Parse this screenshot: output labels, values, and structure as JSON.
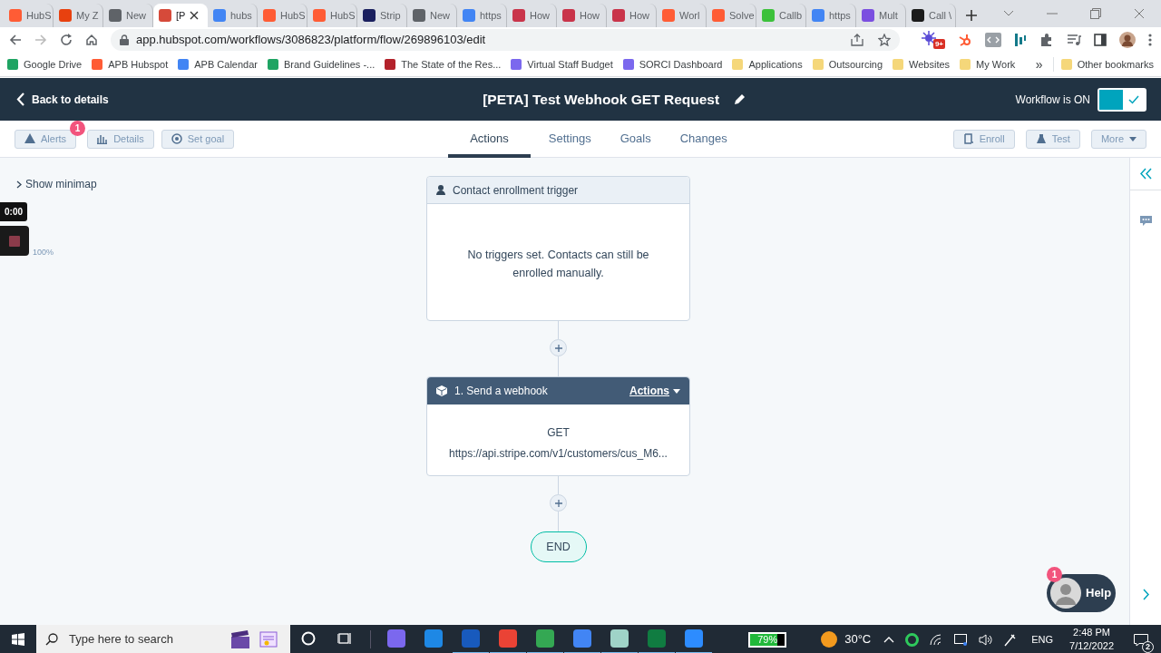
{
  "browser": {
    "tabs": [
      {
        "title": "HubS",
        "color": "#ff5c35",
        "selected": false
      },
      {
        "title": "My Z",
        "color": "#e8410f",
        "selected": false
      },
      {
        "title": "New",
        "color": "#5f6368",
        "selected": false
      },
      {
        "title": "[P",
        "color": "#d64a3a",
        "selected": true
      },
      {
        "title": "hubs",
        "color": "#4285f4",
        "selected": false
      },
      {
        "title": "HubS",
        "color": "#ff5c35",
        "selected": false
      },
      {
        "title": "HubS",
        "color": "#ff5c35",
        "selected": false
      },
      {
        "title": "Strip",
        "color": "#1a1f5e",
        "selected": false
      },
      {
        "title": "New",
        "color": "#5f6368",
        "selected": false
      },
      {
        "title": "https",
        "color": "#4285f4",
        "selected": false
      },
      {
        "title": "How",
        "color": "#c9344a",
        "selected": false
      },
      {
        "title": "How",
        "color": "#c9344a",
        "selected": false
      },
      {
        "title": "How",
        "color": "#c9344a",
        "selected": false
      },
      {
        "title": "Worl",
        "color": "#ff5c35",
        "selected": false
      },
      {
        "title": "Solve",
        "color": "#ff5c35",
        "selected": false
      },
      {
        "title": "Callb",
        "color": "#3cc13b",
        "selected": false
      },
      {
        "title": "https",
        "color": "#4285f4",
        "selected": false
      },
      {
        "title": "Mult",
        "color": "#7b4fe0",
        "selected": false
      },
      {
        "title": "Call \\",
        "color": "#1b1b1b",
        "selected": false
      }
    ],
    "forward_disabled": true,
    "url": "app.hubspot.com/workflows/3086823/platform/flow/269896103/edit",
    "extension_badge": "9+",
    "bookmarks": [
      {
        "label": "Google Drive",
        "color": "#1fa463"
      },
      {
        "label": "APB Hubspot",
        "color": "#ff5c35"
      },
      {
        "label": "APB Calendar",
        "color": "#4285f4"
      },
      {
        "label": "Brand Guidelines -...",
        "color": "#1fa463"
      },
      {
        "label": "The State of the Res...",
        "color": "#b3222b"
      },
      {
        "label": "Virtual Staff Budget",
        "color": "#7b68ee"
      },
      {
        "label": "SORCI Dashboard",
        "color": "#7b68ee"
      },
      {
        "label": "Applications",
        "color": "#f5d77a"
      },
      {
        "label": "Outsourcing",
        "color": "#f5d77a"
      },
      {
        "label": "Websites",
        "color": "#f5d77a"
      },
      {
        "label": "My Work",
        "color": "#f5d77a"
      }
    ],
    "more_bookmarks": "»",
    "other_bookmarks": "Other bookmarks"
  },
  "header": {
    "back": "Back to details",
    "title": "[PETA] Test Webhook GET Request",
    "status": "Workflow is ON",
    "enabled": true
  },
  "left_buttons": [
    {
      "kind": "alert",
      "label": "Alerts",
      "badge": "1"
    },
    {
      "kind": "details",
      "label": "Details"
    },
    {
      "kind": "goal",
      "label": "Set goal"
    }
  ],
  "tabs": [
    {
      "label": "Actions",
      "selected": true
    },
    {
      "label": "Settings",
      "selected": false
    },
    {
      "label": "Goals",
      "selected": false
    },
    {
      "label": "Changes",
      "selected": false
    }
  ],
  "right_buttons": [
    {
      "kind": "enroll",
      "label": "Enroll"
    },
    {
      "kind": "test",
      "label": "Test"
    },
    {
      "kind": "more",
      "label": "More"
    }
  ],
  "canvas": {
    "minimap": "Show minimap",
    "recorder_time": "0:00",
    "zoom": "100%",
    "trigger": {
      "title": "Contact enrollment trigger",
      "message": "No triggers set. Contacts can still be enrolled manually."
    },
    "action": {
      "title": "1. Send a webhook",
      "menu": "Actions",
      "method": "GET",
      "url": "https://api.stripe.com/v1/customers/cus_M6..."
    },
    "end": "END"
  },
  "help": {
    "label": "Help",
    "badge": "1"
  },
  "taskbar": {
    "search_placeholder": "Type here to search",
    "apps": [
      {
        "color": "#7b68ee",
        "running": false
      },
      {
        "color": "#1e88e5",
        "running": false
      },
      {
        "color": "#185abd",
        "running": true
      },
      {
        "color": "#ea4335",
        "running": true
      },
      {
        "color": "#34a853",
        "running": true
      },
      {
        "color": "#4285f4",
        "running": true
      },
      {
        "color": "#9fd3c7",
        "running": true
      },
      {
        "color": "#107c41",
        "running": true
      },
      {
        "color": "#2d8cff",
        "running": true
      }
    ],
    "battery": {
      "level": 0.79,
      "reading": "79%"
    },
    "weather": "30°C",
    "language": "ENG",
    "time": "2:48 PM",
    "date": "7/12/2022",
    "notifications": "2"
  }
}
